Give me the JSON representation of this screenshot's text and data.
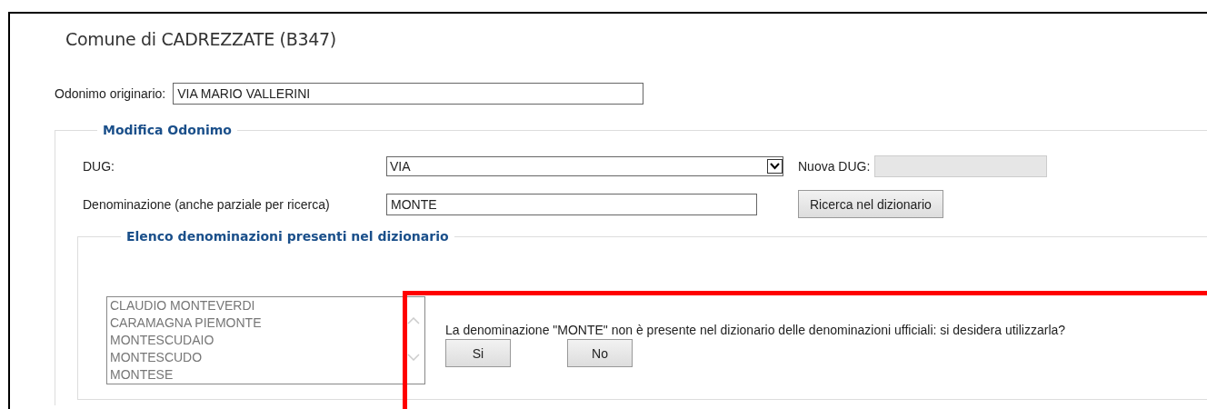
{
  "page_title": "Comune di CADREZZATE (B347)",
  "original_street": {
    "label": "Odonimo originario:",
    "value": "VIA MARIO VALLERINI"
  },
  "modify_section": {
    "legend": "Modifica Odonimo",
    "dug": {
      "label": "DUG:",
      "value": "VIA"
    },
    "new_dug": {
      "label": "Nuova DUG:",
      "disabled": true
    },
    "name": {
      "label": "Denominazione (anche parziale per ricerca)",
      "value": "MONTE"
    },
    "search_button": "Ricerca nel dizionario",
    "dictionary": {
      "legend": "Elenco denominazioni presenti nel dizionario",
      "items": [
        {
          "label": "CLAUDIO MONTEVERDI",
          "selected": false
        },
        {
          "label": "CARAMAGNA PIEMONTE",
          "selected": false
        },
        {
          "label": "MONTESCUDAIO",
          "selected": false
        },
        {
          "label": "MONTESCUDO",
          "selected": false
        },
        {
          "label": "MONTESE",
          "selected": false
        }
      ]
    }
  },
  "confirm": {
    "message": "La denominazione \"MONTE\" non è presente nel dizionario delle denominazioni ufficiali: si desidera utilizzarla?",
    "buttons": [
      "Si",
      "No"
    ]
  }
}
